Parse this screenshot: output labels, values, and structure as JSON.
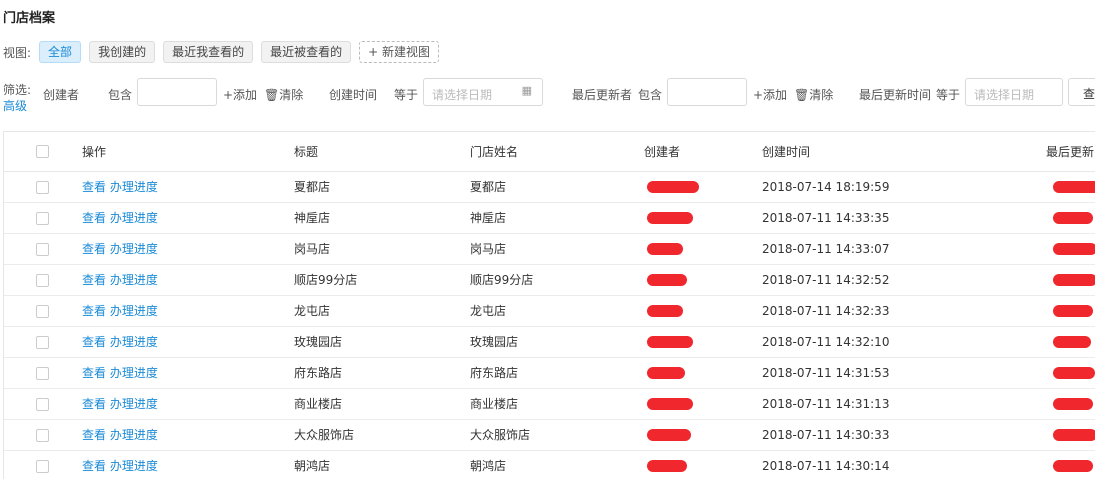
{
  "page_title": "门店档案",
  "views": {
    "label": "视图:",
    "buttons": [
      "全部",
      "我创建的",
      "最近我查看的",
      "最近被查看的"
    ],
    "active_index": 0,
    "new_view": "+ 新建视图"
  },
  "filter": {
    "label": "筛选:",
    "advanced": "高级",
    "creator_label": "创建者",
    "contains": "包含",
    "add": "+添加",
    "clear_icon": "trash-icon",
    "clear": "清除",
    "created_time_label": "创建时间",
    "equals": "等于",
    "date_placeholder": "请选择日期",
    "calendar_icon": "calendar-icon",
    "updater_label": "最后更新者",
    "contains2": "包含",
    "updated_time_label": "最后更新时间",
    "equals2": "等于",
    "query_button": "查"
  },
  "table": {
    "columns": [
      "操作",
      "标题",
      "门店姓名",
      "创建者",
      "创建时间",
      "最后更新"
    ],
    "action_view": "查看",
    "action_progress": "办理进度",
    "redaction_color": "#f0282d",
    "rows": [
      {
        "title": "夏都店",
        "store_name": "夏都店",
        "created_time": "2018-07-14 18:19:59"
      },
      {
        "title": "神垕店",
        "store_name": "神垕店",
        "created_time": "2018-07-11 14:33:35"
      },
      {
        "title": "岗马店",
        "store_name": "岗马店",
        "created_time": "2018-07-11 14:33:07"
      },
      {
        "title": "顺店99分店",
        "store_name": "顺店99分店",
        "created_time": "2018-07-11 14:32:52"
      },
      {
        "title": "龙屯店",
        "store_name": "龙屯店",
        "created_time": "2018-07-11 14:32:33"
      },
      {
        "title": "玫瑰园店",
        "store_name": "玫瑰园店",
        "created_time": "2018-07-11 14:32:10"
      },
      {
        "title": "府东路店",
        "store_name": "府东路店",
        "created_time": "2018-07-11 14:31:53"
      },
      {
        "title": "商业楼店",
        "store_name": "商业楼店",
        "created_time": "2018-07-11 14:31:13"
      },
      {
        "title": "大众服饰店",
        "store_name": "大众服饰店",
        "created_time": "2018-07-11 14:30:33"
      },
      {
        "title": "朝鸿店",
        "store_name": "朝鸿店",
        "created_time": "2018-07-11 14:30:14"
      }
    ]
  }
}
